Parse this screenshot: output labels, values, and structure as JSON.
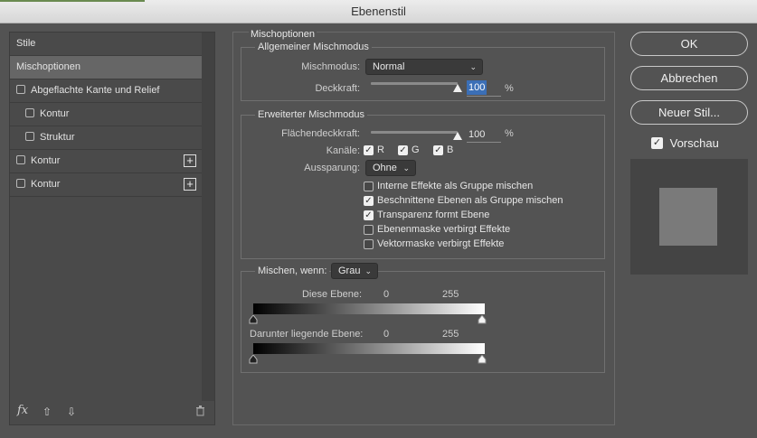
{
  "window": {
    "title": "Ebenenstil"
  },
  "sidebar": {
    "items": [
      {
        "label": "Stile"
      },
      {
        "label": "Mischoptionen"
      },
      {
        "label": "Abgeflachte Kante und Relief"
      },
      {
        "label": "Kontur"
      },
      {
        "label": "Struktur"
      },
      {
        "label": "Kontur"
      },
      {
        "label": "Kontur"
      }
    ],
    "footer": {
      "fx_label": "fx"
    }
  },
  "blend": {
    "section_title": "Mischoptionen",
    "general": {
      "legend": "Allgemeiner Mischmodus",
      "mode_label": "Mischmodus:",
      "mode_value": "Normal",
      "opacity_label": "Deckkraft:",
      "opacity_value": "100",
      "opacity_unit": "%",
      "opacity_level": 1.0
    },
    "advanced": {
      "legend": "Erweiterter Mischmodus",
      "fill_label": "Flächendeckkraft:",
      "fill_value": "100",
      "fill_unit": "%",
      "fill_level": 1.0,
      "channels_label": "Kanäle:",
      "channels": [
        {
          "label": "R",
          "checked": true
        },
        {
          "label": "G",
          "checked": true
        },
        {
          "label": "B",
          "checked": true
        }
      ],
      "knockout_label": "Aussparung:",
      "knockout_value": "Ohne",
      "options": [
        {
          "label": "Interne Effekte als Gruppe mischen",
          "checked": false
        },
        {
          "label": "Beschnittene Ebenen als Gruppe mischen",
          "checked": true
        },
        {
          "label": "Transparenz formt Ebene",
          "checked": true
        },
        {
          "label": "Ebenenmaske verbirgt Effekte",
          "checked": false
        },
        {
          "label": "Vektormaske verbirgt Effekte",
          "checked": false
        }
      ]
    },
    "blend_if": {
      "label": "Mischen, wenn:",
      "value": "Grau",
      "this_layer": {
        "label": "Diese Ebene:",
        "min": "0",
        "max": "255"
      },
      "underlying_layer": {
        "label": "Darunter liegende Ebene:",
        "min": "0",
        "max": "255"
      }
    }
  },
  "buttons": {
    "ok": "OK",
    "cancel": "Abbrechen",
    "new_style": "Neuer Stil..."
  },
  "preview": {
    "label": "Vorschau",
    "checked": true
  },
  "colors": {
    "selection": "#666666",
    "highlight": "#3b6fb6"
  }
}
